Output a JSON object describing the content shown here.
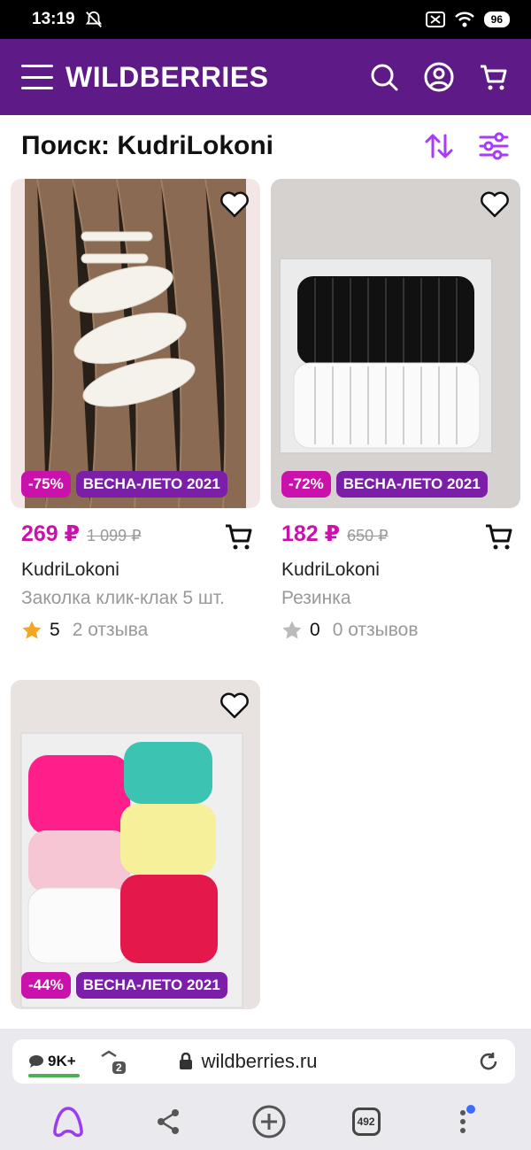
{
  "status_bar": {
    "time": "13:19",
    "battery": "96"
  },
  "header": {
    "brand": "WILDBERRIES"
  },
  "search": {
    "title": "Поиск: KudriLokoni"
  },
  "colors": {
    "brand": "#5e1a87",
    "price": "#cb11ab",
    "discount_badge": "#cb11ab",
    "season_badge": "#7b1ea8",
    "star_filled": "#f5a623",
    "star_empty": "#bbbbbb"
  },
  "products": [
    {
      "discount": "-75%",
      "season": "ВЕСНА-ЛЕТО 2021",
      "price": "269 ₽",
      "old_price": "1 099 ₽",
      "brand": "KudriLokoni",
      "name": "Заколка клик-клак 5 шт.",
      "rating": "5",
      "reviews": "2 отзыва",
      "image": "pearl-hair-clips"
    },
    {
      "discount": "-72%",
      "season": "ВЕСНА-ЛЕТО 2021",
      "price": "182 ₽",
      "old_price": "650 ₽",
      "brand": "KudriLokoni",
      "name": "Резинка",
      "rating": "0",
      "reviews": "0 отзывов",
      "image": "black-white-hair-ties"
    },
    {
      "discount": "-44%",
      "season": "ВЕСНА-ЛЕТО 2021",
      "image": "colorful-hair-ties"
    }
  ],
  "browser": {
    "comments": "9K+",
    "tabs_small": "2",
    "url": "wildberries.ru",
    "tabs_count": "492"
  }
}
